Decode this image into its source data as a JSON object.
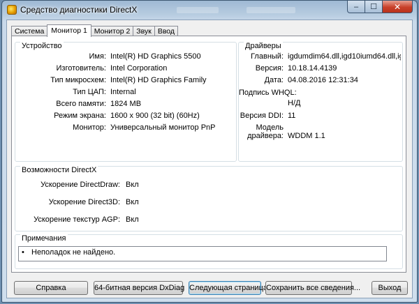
{
  "window": {
    "title": "Средство диагностики DirectX",
    "caption_buttons": {
      "minimize": "–",
      "maximize": "☐",
      "close": "✕"
    }
  },
  "tabs": [
    {
      "label": "Система",
      "active": false
    },
    {
      "label": "Монитор 1",
      "active": true
    },
    {
      "label": "Монитор 2",
      "active": false
    },
    {
      "label": "Звук",
      "active": false
    },
    {
      "label": "Ввод",
      "active": false
    }
  ],
  "device": {
    "heading": "Устройство",
    "rows": [
      {
        "label": "Имя:",
        "value": "Intel(R) HD Graphics 5500"
      },
      {
        "label": "Изготовитель:",
        "value": "Intel Corporation"
      },
      {
        "label": "Тип микросхем:",
        "value": "Intel(R) HD Graphics Family"
      },
      {
        "label": "Тип ЦАП:",
        "value": "Internal"
      },
      {
        "label": "Всего памяти:",
        "value": "1824 MB"
      },
      {
        "label": "Режим экрана:",
        "value": "1600 x 900 (32 bit) (60Hz)"
      },
      {
        "label": "Монитор:",
        "value": "Универсальный монитор PnP"
      }
    ]
  },
  "drivers": {
    "heading": "Драйверы",
    "main_label": "Главный:",
    "main_value": "igdumdim64.dll,igd10iumd64.dll,igd10",
    "version_label": "Версия:",
    "version_value": "10.18.14.4139",
    "date_label": "Дата:",
    "date_value": "04.08.2016 12:31:34",
    "whql_label": "Подпись WHQL:",
    "whql_value": "Н/Д",
    "ddi_label": "Версия DDI:",
    "ddi_value": "11",
    "model_label_1": "Модель",
    "model_label_2": "драйвера:",
    "model_value": "WDDM 1.1"
  },
  "directx": {
    "heading": "Возможности DirectX",
    "rows": [
      {
        "label": "Ускорение DirectDraw:",
        "value": "Вкл"
      },
      {
        "label": "Ускорение Direct3D:",
        "value": "Вкл"
      },
      {
        "label": "Ускорение текстур AGP:",
        "value": "Вкл"
      }
    ]
  },
  "notes": {
    "heading": "Примечания",
    "bullet": "•",
    "items": [
      "Неполадок не найдено."
    ]
  },
  "buttons": {
    "help": "Справка",
    "dxdiag64": "64-битная версия DxDiag",
    "next_page": "Следующая страница",
    "save_all": "Сохранить все сведения...",
    "exit": "Выход"
  }
}
